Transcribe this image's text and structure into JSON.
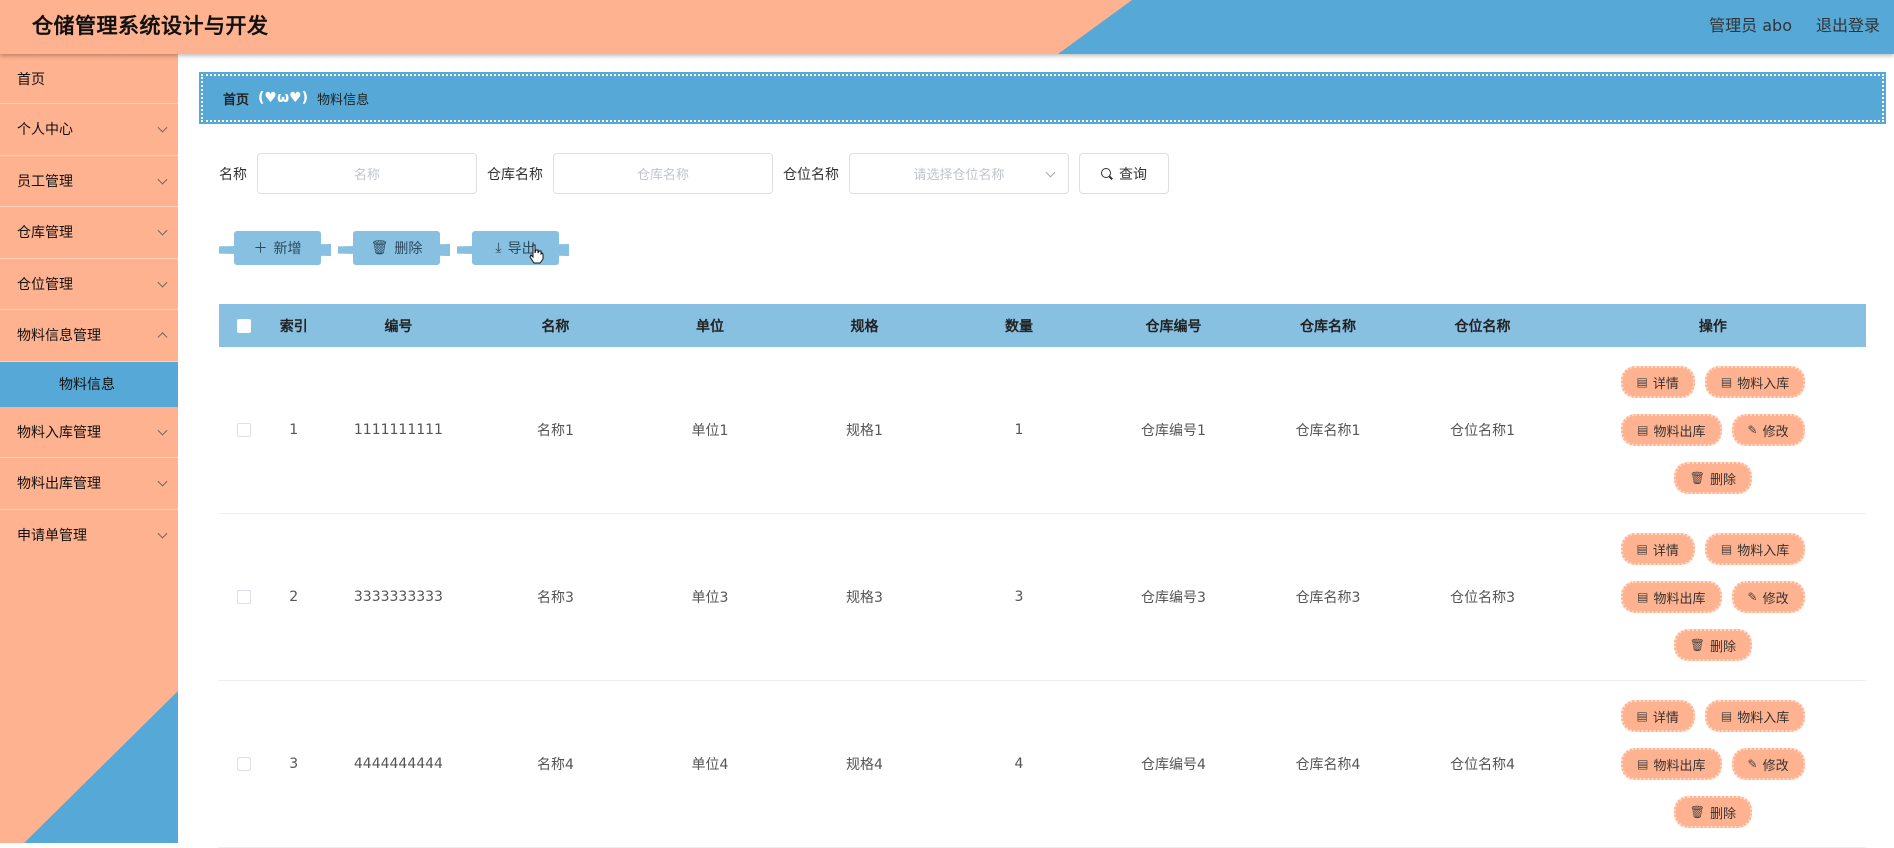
{
  "header": {
    "title": "仓储管理系统设计与开发",
    "user": "管理员 abo",
    "logout": "退出登录"
  },
  "sidebar": {
    "items": [
      {
        "label": "首页",
        "has_chevron": false
      },
      {
        "label": "个人中心",
        "has_chevron": true
      },
      {
        "label": "员工管理",
        "has_chevron": true
      },
      {
        "label": "仓库管理",
        "has_chevron": true
      },
      {
        "label": "仓位管理",
        "has_chevron": true
      },
      {
        "label": "物料信息管理",
        "has_chevron": true
      }
    ],
    "active_sub": "物料信息",
    "items_after": [
      {
        "label": "物料入库管理",
        "has_chevron": true
      },
      {
        "label": "物料出库管理",
        "has_chevron": true
      },
      {
        "label": "申请单管理",
        "has_chevron": true
      }
    ]
  },
  "breadcrumb": {
    "home": "首页",
    "separator": "(♥ω♥)",
    "current": "物料信息"
  },
  "search": {
    "name_label": "名称",
    "name_placeholder": "名称",
    "warehouse_label": "仓库名称",
    "warehouse_placeholder": "仓库名称",
    "location_label": "仓位名称",
    "location_placeholder": "请选择仓位名称",
    "query_button": "查询"
  },
  "actions": {
    "add": "新增",
    "delete": "删除",
    "export": "导出"
  },
  "table": {
    "headers": [
      "索引",
      "编号",
      "名称",
      "单位",
      "规格",
      "数量",
      "仓库编号",
      "仓库名称",
      "仓位名称",
      "操作"
    ],
    "rows": [
      {
        "idx": "1",
        "code": "1111111111",
        "name": "名称1",
        "unit": "单位1",
        "spec": "规格1",
        "qty": "1",
        "wh_code": "仓库编号1",
        "wh_name": "仓库名称1",
        "loc": "仓位名称1"
      },
      {
        "idx": "2",
        "code": "3333333333",
        "name": "名称3",
        "unit": "单位3",
        "spec": "规格3",
        "qty": "3",
        "wh_code": "仓库编号3",
        "wh_name": "仓库名称3",
        "loc": "仓位名称3"
      },
      {
        "idx": "3",
        "code": "4444444444",
        "name": "名称4",
        "unit": "单位4",
        "spec": "规格4",
        "qty": "4",
        "wh_code": "仓库编号4",
        "wh_name": "仓库名称4",
        "loc": "仓位名称4"
      }
    ],
    "row_ops": [
      "详情",
      "物料入库",
      "物料出库",
      "修改",
      "删除"
    ]
  },
  "colors": {
    "peach": "#ffb28f",
    "blue": "#56a8d6",
    "light_blue": "#87c0e0"
  },
  "icons": {
    "doc": "document-icon",
    "edit": "edit-icon",
    "trash": "trash-icon",
    "plus": "plus-icon",
    "download": "download-icon",
    "search": "search-icon"
  }
}
